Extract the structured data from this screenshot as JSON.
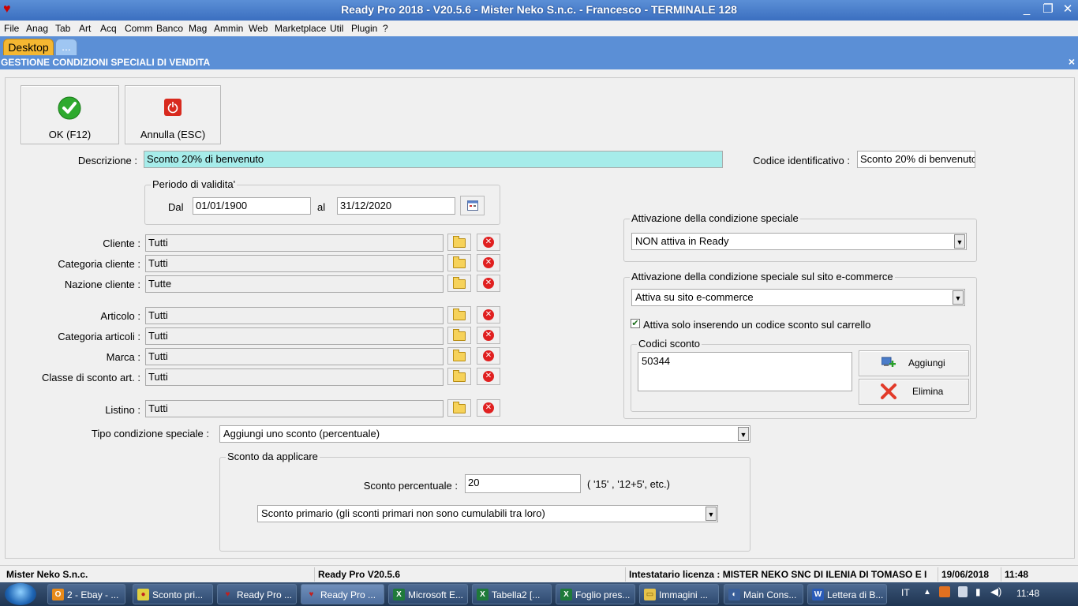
{
  "window": {
    "title": "Ready Pro 2018 - V20.5.6 - Mister Neko S.n.c. - Francesco - TERMINALE 128"
  },
  "menu": [
    "File",
    "Anag",
    "Tab",
    "Art",
    "Acq",
    "Comm",
    "Banco",
    "Mag",
    "Ammin",
    "Web",
    "Marketplace",
    "Util",
    "Plugin",
    "?"
  ],
  "tabs": {
    "desktop": "Desktop",
    "more": "..."
  },
  "header": {
    "title": "GESTIONE CONDIZIONI SPECIALI DI VENDITA",
    "close": "×"
  },
  "toolbar": {
    "ok_label": "OK (F12)",
    "cancel_label": "Annulla (ESC)"
  },
  "form": {
    "descrizione_label": "Descrizione :",
    "descrizione_value": "Sconto 20% di benvenuto",
    "codice_label": "Codice identificativo :",
    "codice_value": "Sconto 20% di benvenuto",
    "periodo": {
      "title": "Periodo di validita'",
      "dal_label": "Dal",
      "dal_value": "01/01/1900",
      "al_label": "al",
      "al_value": "31/12/2020"
    },
    "filters": [
      {
        "label": "Cliente :",
        "value": "Tutti"
      },
      {
        "label": "Categoria cliente :",
        "value": "Tutti"
      },
      {
        "label": "Nazione cliente :",
        "value": "Tutte"
      },
      {
        "label": "Articolo :",
        "value": "Tutti"
      },
      {
        "label": "Categoria articoli :",
        "value": "Tutti"
      },
      {
        "label": "Marca :",
        "value": "Tutti"
      },
      {
        "label": "Classe di sconto art. :",
        "value": "Tutti"
      },
      {
        "label": "Listino :",
        "value": "Tutti"
      }
    ],
    "tipo_label": "Tipo condizione speciale :",
    "tipo_value": "Aggiungi uno sconto (percentuale)",
    "sconto_group": "Sconto da applicare",
    "sconto_label": "Sconto percentuale :",
    "sconto_value": "20",
    "sconto_hint": "( '15' ,  '12+5', etc.)",
    "sconto_tipo_value": "Sconto primario (gli sconti primari non sono cumulabili tra loro)"
  },
  "attivazione": {
    "title": "Attivazione della condizione speciale",
    "value": "NON attiva in Ready",
    "ecommerce_title": "Attivazione della condizione speciale sul sito e-commerce",
    "ecommerce_value": "Attiva su sito e-commerce",
    "checkbox_label": "Attiva solo inserendo un codice sconto sul carrello",
    "checkbox_checked": true,
    "codici_title": "Codici sconto",
    "codici": [
      "50344"
    ],
    "aggiungi_label": "Aggiungi",
    "elimina_label": "Elimina"
  },
  "status": {
    "company": "Mister Neko S.n.c.",
    "version": "Ready Pro V20.5.6",
    "licenza": "Intestatario licenza : MISTER NEKO SNC DI ILENIA DI TOMASO E I",
    "date": "19/06/2018",
    "time": "11:48"
  },
  "taskbar": {
    "items": [
      {
        "label": "2 - Ebay - ...",
        "icon": "outlook-icon",
        "color": "#e88a1a",
        "glyph": "O"
      },
      {
        "label": "Sconto pri...",
        "icon": "chrome-icon",
        "color": "#e0d040",
        "glyph": "●"
      },
      {
        "label": "Ready Pro ...",
        "icon": "readypro-icon",
        "color": "#c02020",
        "glyph": "♥"
      },
      {
        "label": "Ready Pro ...",
        "icon": "readypro-icon",
        "color": "#c02020",
        "glyph": "♥"
      },
      {
        "label": "Microsoft E...",
        "icon": "excel-icon",
        "color": "#1f7a3a",
        "glyph": "X"
      },
      {
        "label": "Tabella2  [...",
        "icon": "excel-icon",
        "color": "#1f7a3a",
        "glyph": "X"
      },
      {
        "label": "Foglio pres...",
        "icon": "excel-icon",
        "color": "#1f7a3a",
        "glyph": "X"
      },
      {
        "label": "Immagini ...",
        "icon": "folder-icon",
        "color": "#e6c24a",
        "glyph": "▭"
      },
      {
        "label": "Main Cons...",
        "icon": "console-icon",
        "color": "#3a5f9a",
        "glyph": "◐"
      },
      {
        "label": "Lettera di B...",
        "icon": "word-icon",
        "color": "#2a5bb8",
        "glyph": "W"
      }
    ],
    "lang": "IT",
    "clock": "11:48"
  }
}
